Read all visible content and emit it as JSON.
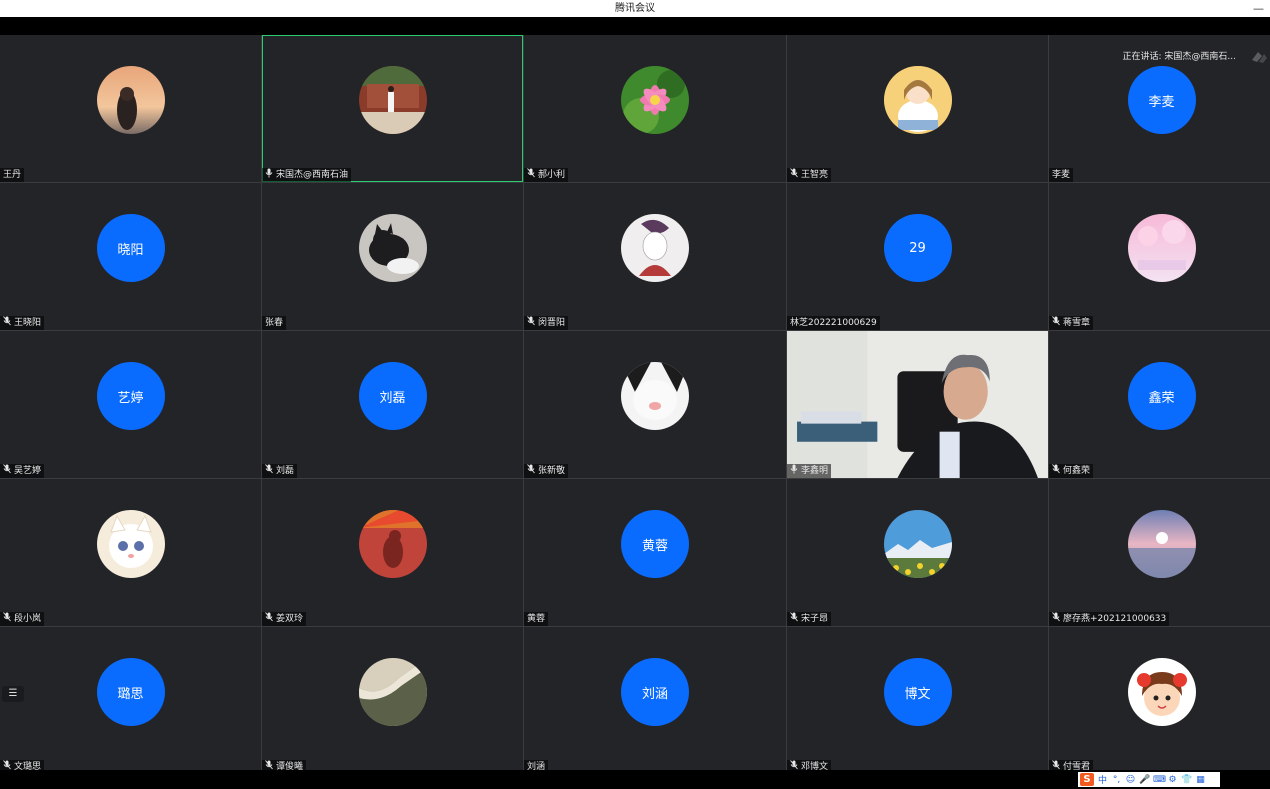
{
  "window": {
    "title": "腾讯会议",
    "minimize_label": "—"
  },
  "speaking_label": "正在讲话: 宋国杰@西南石...",
  "participants": [
    {
      "name": "王丹",
      "avatar": "photo-sunset-girl",
      "mic": false
    },
    {
      "name": "宋国杰@西南石油",
      "avatar": "photo-building",
      "mic": true,
      "active": true
    },
    {
      "name": "郝小利",
      "avatar": "photo-lotus",
      "mic": true
    },
    {
      "name": "王智亮",
      "avatar": "photo-cartoon-girl",
      "mic": true
    },
    {
      "name": "李麦",
      "avatar_text": "李麦",
      "mic": false
    },
    {
      "name": "王晓阳",
      "avatar_text": "晓阳",
      "mic": true
    },
    {
      "name": "张春",
      "avatar": "photo-black-cat",
      "mic": false
    },
    {
      "name": "闵晋阳",
      "avatar": "photo-sketch",
      "mic": true
    },
    {
      "name": "林芝202221000629",
      "avatar_text": "29",
      "mic": false
    },
    {
      "name": "蒋雪章",
      "avatar": "photo-pink-sky",
      "mic": true
    },
    {
      "name": "吴艺婷",
      "avatar_text": "艺婷",
      "mic": true
    },
    {
      "name": "刘磊",
      "avatar_text": "刘磊",
      "mic": true
    },
    {
      "name": "张新敬",
      "avatar": "photo-cat-face",
      "mic": true
    },
    {
      "name": "李鑫明",
      "video": true,
      "mic": true
    },
    {
      "name": "何鑫荣",
      "avatar_text": "鑫荣",
      "mic": true
    },
    {
      "name": "段小岚",
      "avatar": "photo-white-kitten",
      "mic": true
    },
    {
      "name": "姜双玲",
      "avatar": "photo-red-wall",
      "mic": true
    },
    {
      "name": "黄蓉",
      "avatar_text": "黄蓉",
      "mic": false
    },
    {
      "name": "宋子昂",
      "avatar": "photo-mountain",
      "mic": true
    },
    {
      "name": "廖存燕+202121000633",
      "avatar": "photo-sea-sunset",
      "mic": true
    },
    {
      "name": "文璐思",
      "avatar_text": "璐思",
      "mic": true
    },
    {
      "name": "谭俊曦",
      "avatar": "photo-coast",
      "mic": true
    },
    {
      "name": "刘涵",
      "avatar_text": "刘涵",
      "mic": false
    },
    {
      "name": "邓博文",
      "avatar_text": "博文",
      "mic": true
    },
    {
      "name": "付雪君",
      "avatar": "photo-cartoon-face",
      "mic": true
    }
  ],
  "ime_toolbar": {
    "logo": "S",
    "items": [
      "中",
      "°,",
      "☺",
      "🎤",
      "⌨",
      "⚙",
      "👕",
      "▦"
    ]
  },
  "colors": {
    "avatar_blue": "#0a6cff",
    "active_border": "#2ecc71",
    "tile_bg": "#232428"
  }
}
